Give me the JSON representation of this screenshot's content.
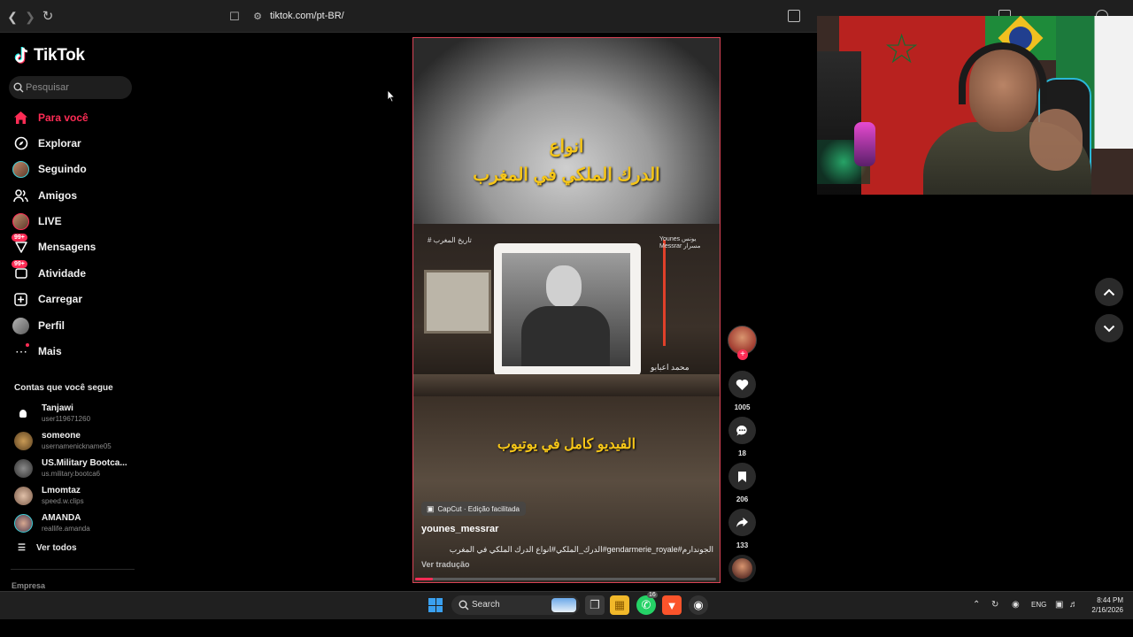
{
  "browser": {
    "url": "tiktok.com/pt-BR/"
  },
  "sidebar": {
    "logo_text": "TikTok",
    "search_placeholder": "Pesquisar",
    "nav": [
      {
        "label": "Para você",
        "icon": "home-icon",
        "active": true
      },
      {
        "label": "Explorar",
        "icon": "compass-icon"
      },
      {
        "label": "Seguindo",
        "icon": "following-avatar-icon"
      },
      {
        "label": "Amigos",
        "icon": "friends-icon"
      },
      {
        "label": "LIVE",
        "icon": "live-avatar-icon"
      },
      {
        "label": "Mensagens",
        "icon": "messages-icon",
        "badge": "99+"
      },
      {
        "label": "Atividade",
        "icon": "activity-icon",
        "badge": "99+"
      },
      {
        "label": "Carregar",
        "icon": "upload-icon"
      },
      {
        "label": "Perfil",
        "icon": "profile-avatar-icon"
      },
      {
        "label": "Mais",
        "icon": "more-icon"
      }
    ],
    "following_title": "Contas que você segue",
    "accounts": [
      {
        "name": "Tanjawi",
        "username": "user119671260"
      },
      {
        "name": "someone",
        "username": "usernamenickname05"
      },
      {
        "name": "US.Military Bootca...",
        "username": "us.military.bootca6"
      },
      {
        "name": "Lmomtaz",
        "username": "speed.w.clips"
      },
      {
        "name": "AMANDA",
        "username": "reallife.amanda"
      }
    ],
    "see_all": "Ver todos",
    "company": "Empresa"
  },
  "video": {
    "title_line1": "انواع",
    "title_line2": "الدرك الملكي في المغرب",
    "hashtag_overlay": "# تاريخ المغرب",
    "name_overlay_line1": "Younes يونس",
    "name_overlay_line2": "Messrar مسرار",
    "name_arabic": "محمد اعبابو",
    "full_video_text": "الفيديو كامل في يوتيوب",
    "capcut_label": "CapCut · Edição facilitada",
    "author": "younes_messrar",
    "caption": "الجوندارم#gendarmerie_royale#الدرك_الملكي#انواع الدرك الملكي في المغرب",
    "translate_label": "Ver tradução",
    "progress": 0.06
  },
  "actions": {
    "likes": "1005",
    "comments": "18",
    "saves": "206",
    "shares": "133"
  },
  "taskbar": {
    "search_label": "Search",
    "language": "ENG",
    "time": "8:44 PM",
    "date": "2/16/2026",
    "whatsapp_badge": "16"
  },
  "colors": {
    "accent": "#fe2c55",
    "caption_yellow": "#f5c518"
  }
}
